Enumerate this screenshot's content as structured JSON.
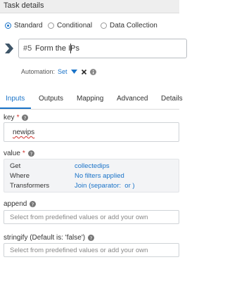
{
  "header": {
    "title": "Task details"
  },
  "task_type": {
    "options": [
      {
        "label": "Standard",
        "selected": true
      },
      {
        "label": "Conditional",
        "selected": false
      },
      {
        "label": "Data Collection",
        "selected": false
      }
    ]
  },
  "task_name": {
    "prefix": "#5",
    "value": "Form the IPs"
  },
  "automation": {
    "label": "Automation:",
    "value": "Set"
  },
  "tabs": [
    {
      "label": "Inputs",
      "active": true
    },
    {
      "label": "Outputs",
      "active": false
    },
    {
      "label": "Mapping",
      "active": false
    },
    {
      "label": "Advanced",
      "active": false
    },
    {
      "label": "Details",
      "active": false
    }
  ],
  "fields": {
    "key": {
      "label": "key",
      "required_mark": "*",
      "value": "newips"
    },
    "value": {
      "label": "value",
      "required_mark": "*",
      "rows": [
        {
          "key": "Get",
          "value": "collectedips"
        },
        {
          "key": "Where",
          "value": "No filters applied"
        },
        {
          "key": "Transformers",
          "value": "Join (separator:  or )"
        }
      ]
    },
    "append": {
      "label": "append",
      "placeholder": "Select from predefined values or add your own"
    },
    "stringify": {
      "label": "stringify (Default is: 'false')",
      "placeholder": "Select from predefined values or add your own"
    }
  },
  "colors": {
    "accent": "#1a73c8",
    "required": "#d0322d",
    "header_bg": "#eeeeee",
    "value_box_bg": "#f3f4f6"
  },
  "icons": [
    "chevron-right-icon",
    "caret-down-icon",
    "close-icon",
    "info-icon",
    "help-icon"
  ]
}
